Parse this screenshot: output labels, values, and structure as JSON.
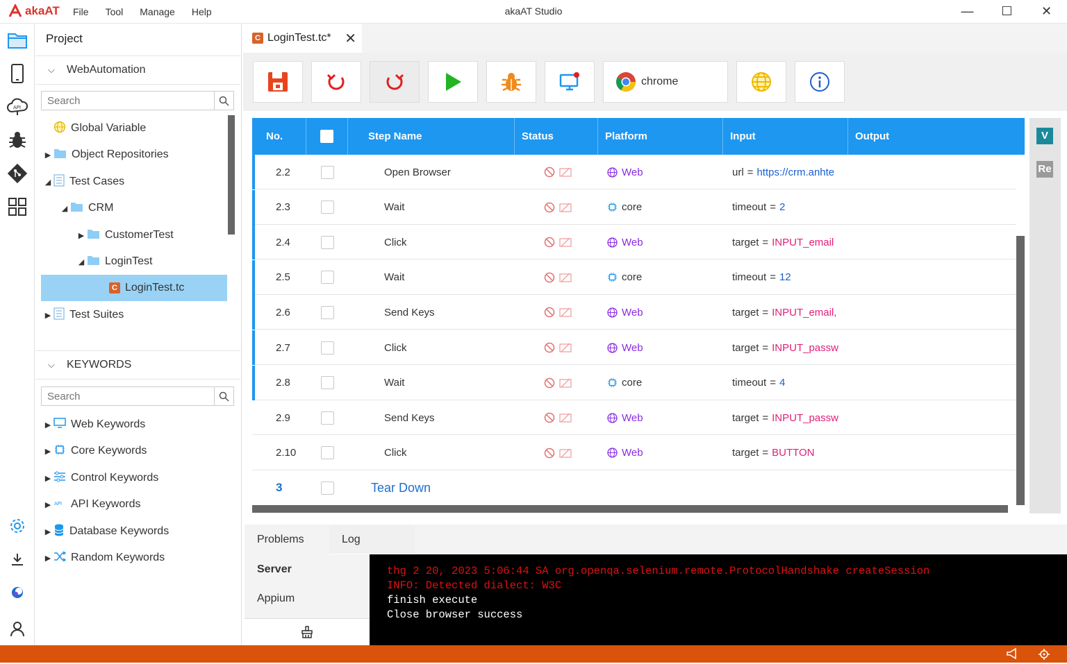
{
  "app": {
    "logo_text": "akaAT",
    "menu": [
      "File",
      "Tool",
      "Manage",
      "Help"
    ],
    "title": "akaAT Studio",
    "controls": {
      "minimize": "—",
      "maximize": "☐",
      "close": "✕"
    }
  },
  "sidebar": {
    "header": "Project",
    "project_section": "WebAutomation",
    "search_placeholder": "Search",
    "tree": [
      {
        "label": "Global Variable",
        "expander": ""
      },
      {
        "label": "Object Repositories",
        "expander": "▶"
      },
      {
        "label": "Test Cases",
        "expander": "◢"
      },
      {
        "label": "CRM",
        "expander": "◢"
      },
      {
        "label": "CustomerTest",
        "expander": "▶"
      },
      {
        "label": "LoginTest",
        "expander": "◢"
      },
      {
        "label": "LoginTest.tc",
        "expander": ""
      },
      {
        "label": "Test Suites",
        "expander": "▶"
      }
    ],
    "keywords_section": "KEYWORDS",
    "keywords_search_placeholder": "Search",
    "keywords": [
      "Web Keywords",
      "Core Keywords",
      "Control Keywords",
      "API Keywords",
      "Database Keywords",
      "Random Keywords"
    ]
  },
  "editor": {
    "tab_label": "LoginTest.tc*",
    "tab_icon_letter": "C",
    "browser_label": "chrome"
  },
  "grid": {
    "columns": [
      "No.",
      "",
      "Step Name",
      "Status",
      "Platform",
      "Input",
      "Output"
    ],
    "rows": [
      {
        "no": "2.2",
        "step": "Open Browser",
        "platform": "Web",
        "input_key": "url",
        "input_val": "https://crm.anhte"
      },
      {
        "no": "2.3",
        "step": "Wait",
        "platform": "core",
        "input_key": "timeout",
        "input_val": "2"
      },
      {
        "no": "2.4",
        "step": "Click",
        "platform": "Web",
        "input_key": "target",
        "input_val": "INPUT_email"
      },
      {
        "no": "2.5",
        "step": "Wait",
        "platform": "core",
        "input_key": "timeout",
        "input_val": "12"
      },
      {
        "no": "2.6",
        "step": "Send Keys",
        "platform": "Web",
        "input_key": "target",
        "input_val": "INPUT_email,"
      },
      {
        "no": "2.7",
        "step": "Click",
        "platform": "Web",
        "input_key": "target",
        "input_val": "INPUT_passw"
      },
      {
        "no": "2.8",
        "step": "Wait",
        "platform": "core",
        "input_key": "timeout",
        "input_val": "4"
      },
      {
        "no": "2.9",
        "step": "Send Keys",
        "platform": "Web",
        "input_key": "target",
        "input_val": "INPUT_passw"
      },
      {
        "no": "2.10",
        "step": "Click",
        "platform": "Web",
        "input_key": "target",
        "input_val": "BUTTON"
      }
    ],
    "group_row": {
      "no": "3",
      "step": "Tear Down"
    },
    "equals": "="
  },
  "rightbar": {
    "v_label": "V",
    "re_label": "Re"
  },
  "bottom": {
    "tabs": [
      "Problems",
      "Log"
    ],
    "left_items": [
      "Server",
      "Appium"
    ],
    "console_lines": [
      "thg 2 20, 2023 5:06:44 SA org.openqa.selenium.remote.ProtocolHandshake createSession",
      "INFO: Detected dialect: W3C",
      "finish execute",
      "Close browser success"
    ]
  },
  "colors": {
    "accent": "#1d97f0",
    "status_bar": "#d9530b",
    "error_text": "#e01010",
    "web_platform": "#8a2be2"
  }
}
